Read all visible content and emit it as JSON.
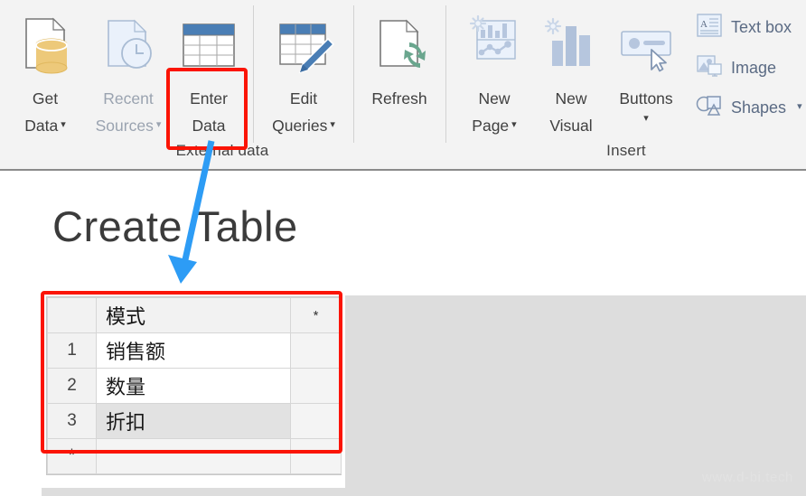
{
  "ribbon": {
    "groups": [
      {
        "label": "External data"
      },
      {
        "label": "Insert"
      }
    ],
    "items": [
      {
        "name": "get-data",
        "line1": "Get",
        "line2": "Data",
        "caret": "▾",
        "icon": "document-database-icon",
        "disabled": false
      },
      {
        "name": "recent-sources",
        "line1": "Recent",
        "line2": "Sources",
        "caret": "▾",
        "icon": "document-clock-icon",
        "disabled": true
      },
      {
        "name": "enter-data",
        "line1": "Enter",
        "line2": "Data",
        "caret": "",
        "icon": "table-icon",
        "disabled": false
      },
      {
        "name": "edit-queries",
        "line1": "Edit",
        "line2": "Queries",
        "caret": "▾",
        "icon": "table-pencil-icon",
        "disabled": false
      },
      {
        "name": "refresh",
        "line1": "Refresh",
        "line2": "",
        "caret": "",
        "icon": "document-refresh-icon",
        "disabled": false
      },
      {
        "name": "new-page",
        "line1": "New",
        "line2": "Page",
        "caret": "▾",
        "icon": "new-page-icon",
        "disabled": false
      },
      {
        "name": "new-visual",
        "line1": "New",
        "line2": "Visual",
        "caret": "",
        "icon": "new-visual-icon",
        "disabled": false
      },
      {
        "name": "buttons",
        "line1": "Buttons",
        "line2": "",
        "caret": "▾",
        "icon": "button-cursor-icon",
        "disabled": false
      }
    ],
    "small_items": [
      {
        "name": "text-box",
        "label": "Text box",
        "caret": "",
        "icon": "text-box-icon"
      },
      {
        "name": "image",
        "label": "Image",
        "caret": "",
        "icon": "image-icon"
      },
      {
        "name": "shapes",
        "label": "Shapes",
        "caret": "▾",
        "icon": "shapes-icon"
      }
    ]
  },
  "page": {
    "title": "Create Table",
    "watermark": "www.d-bi.tech"
  },
  "grid": {
    "header_rownum": "",
    "header_column": "模式",
    "header_star": "*",
    "new_row_marker": "*",
    "rows": [
      {
        "num": "1",
        "value": "销售额",
        "selected": false
      },
      {
        "num": "2",
        "value": "数量",
        "selected": false
      },
      {
        "num": "3",
        "value": "折扣",
        "selected": true
      }
    ]
  },
  "annotations": {
    "highlight_color": "#fb1405",
    "arrow_color": "#2d9cf5",
    "highlight_enter_data": "enter-data-highlight",
    "highlight_grid": "grid-highlight",
    "arrow": "enter-data-to-grid-arrow"
  }
}
